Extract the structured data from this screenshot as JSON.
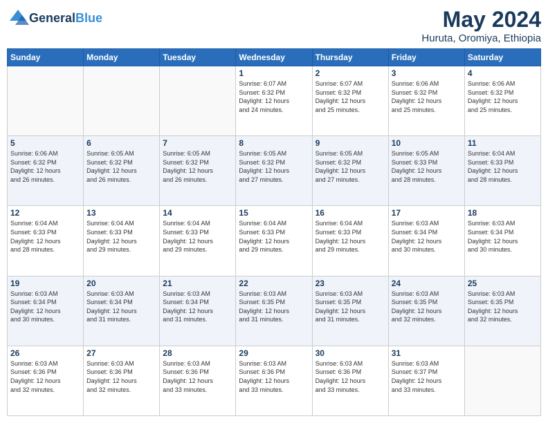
{
  "logo": {
    "general": "General",
    "blue": "Blue",
    "tagline": ""
  },
  "header": {
    "month_year": "May 2024",
    "location": "Huruta, Oromiya, Ethiopia"
  },
  "days_of_week": [
    "Sunday",
    "Monday",
    "Tuesday",
    "Wednesday",
    "Thursday",
    "Friday",
    "Saturday"
  ],
  "weeks": [
    [
      {
        "day": "",
        "info": ""
      },
      {
        "day": "",
        "info": ""
      },
      {
        "day": "",
        "info": ""
      },
      {
        "day": "1",
        "info": "Sunrise: 6:07 AM\nSunset: 6:32 PM\nDaylight: 12 hours\nand 24 minutes."
      },
      {
        "day": "2",
        "info": "Sunrise: 6:07 AM\nSunset: 6:32 PM\nDaylight: 12 hours\nand 25 minutes."
      },
      {
        "day": "3",
        "info": "Sunrise: 6:06 AM\nSunset: 6:32 PM\nDaylight: 12 hours\nand 25 minutes."
      },
      {
        "day": "4",
        "info": "Sunrise: 6:06 AM\nSunset: 6:32 PM\nDaylight: 12 hours\nand 25 minutes."
      }
    ],
    [
      {
        "day": "5",
        "info": "Sunrise: 6:06 AM\nSunset: 6:32 PM\nDaylight: 12 hours\nand 26 minutes."
      },
      {
        "day": "6",
        "info": "Sunrise: 6:05 AM\nSunset: 6:32 PM\nDaylight: 12 hours\nand 26 minutes."
      },
      {
        "day": "7",
        "info": "Sunrise: 6:05 AM\nSunset: 6:32 PM\nDaylight: 12 hours\nand 26 minutes."
      },
      {
        "day": "8",
        "info": "Sunrise: 6:05 AM\nSunset: 6:32 PM\nDaylight: 12 hours\nand 27 minutes."
      },
      {
        "day": "9",
        "info": "Sunrise: 6:05 AM\nSunset: 6:32 PM\nDaylight: 12 hours\nand 27 minutes."
      },
      {
        "day": "10",
        "info": "Sunrise: 6:05 AM\nSunset: 6:33 PM\nDaylight: 12 hours\nand 28 minutes."
      },
      {
        "day": "11",
        "info": "Sunrise: 6:04 AM\nSunset: 6:33 PM\nDaylight: 12 hours\nand 28 minutes."
      }
    ],
    [
      {
        "day": "12",
        "info": "Sunrise: 6:04 AM\nSunset: 6:33 PM\nDaylight: 12 hours\nand 28 minutes."
      },
      {
        "day": "13",
        "info": "Sunrise: 6:04 AM\nSunset: 6:33 PM\nDaylight: 12 hours\nand 29 minutes."
      },
      {
        "day": "14",
        "info": "Sunrise: 6:04 AM\nSunset: 6:33 PM\nDaylight: 12 hours\nand 29 minutes."
      },
      {
        "day": "15",
        "info": "Sunrise: 6:04 AM\nSunset: 6:33 PM\nDaylight: 12 hours\nand 29 minutes."
      },
      {
        "day": "16",
        "info": "Sunrise: 6:04 AM\nSunset: 6:33 PM\nDaylight: 12 hours\nand 29 minutes."
      },
      {
        "day": "17",
        "info": "Sunrise: 6:03 AM\nSunset: 6:34 PM\nDaylight: 12 hours\nand 30 minutes."
      },
      {
        "day": "18",
        "info": "Sunrise: 6:03 AM\nSunset: 6:34 PM\nDaylight: 12 hours\nand 30 minutes."
      }
    ],
    [
      {
        "day": "19",
        "info": "Sunrise: 6:03 AM\nSunset: 6:34 PM\nDaylight: 12 hours\nand 30 minutes."
      },
      {
        "day": "20",
        "info": "Sunrise: 6:03 AM\nSunset: 6:34 PM\nDaylight: 12 hours\nand 31 minutes."
      },
      {
        "day": "21",
        "info": "Sunrise: 6:03 AM\nSunset: 6:34 PM\nDaylight: 12 hours\nand 31 minutes."
      },
      {
        "day": "22",
        "info": "Sunrise: 6:03 AM\nSunset: 6:35 PM\nDaylight: 12 hours\nand 31 minutes."
      },
      {
        "day": "23",
        "info": "Sunrise: 6:03 AM\nSunset: 6:35 PM\nDaylight: 12 hours\nand 31 minutes."
      },
      {
        "day": "24",
        "info": "Sunrise: 6:03 AM\nSunset: 6:35 PM\nDaylight: 12 hours\nand 32 minutes."
      },
      {
        "day": "25",
        "info": "Sunrise: 6:03 AM\nSunset: 6:35 PM\nDaylight: 12 hours\nand 32 minutes."
      }
    ],
    [
      {
        "day": "26",
        "info": "Sunrise: 6:03 AM\nSunset: 6:36 PM\nDaylight: 12 hours\nand 32 minutes."
      },
      {
        "day": "27",
        "info": "Sunrise: 6:03 AM\nSunset: 6:36 PM\nDaylight: 12 hours\nand 32 minutes."
      },
      {
        "day": "28",
        "info": "Sunrise: 6:03 AM\nSunset: 6:36 PM\nDaylight: 12 hours\nand 33 minutes."
      },
      {
        "day": "29",
        "info": "Sunrise: 6:03 AM\nSunset: 6:36 PM\nDaylight: 12 hours\nand 33 minutes."
      },
      {
        "day": "30",
        "info": "Sunrise: 6:03 AM\nSunset: 6:36 PM\nDaylight: 12 hours\nand 33 minutes."
      },
      {
        "day": "31",
        "info": "Sunrise: 6:03 AM\nSunset: 6:37 PM\nDaylight: 12 hours\nand 33 minutes."
      },
      {
        "day": "",
        "info": ""
      }
    ]
  ]
}
